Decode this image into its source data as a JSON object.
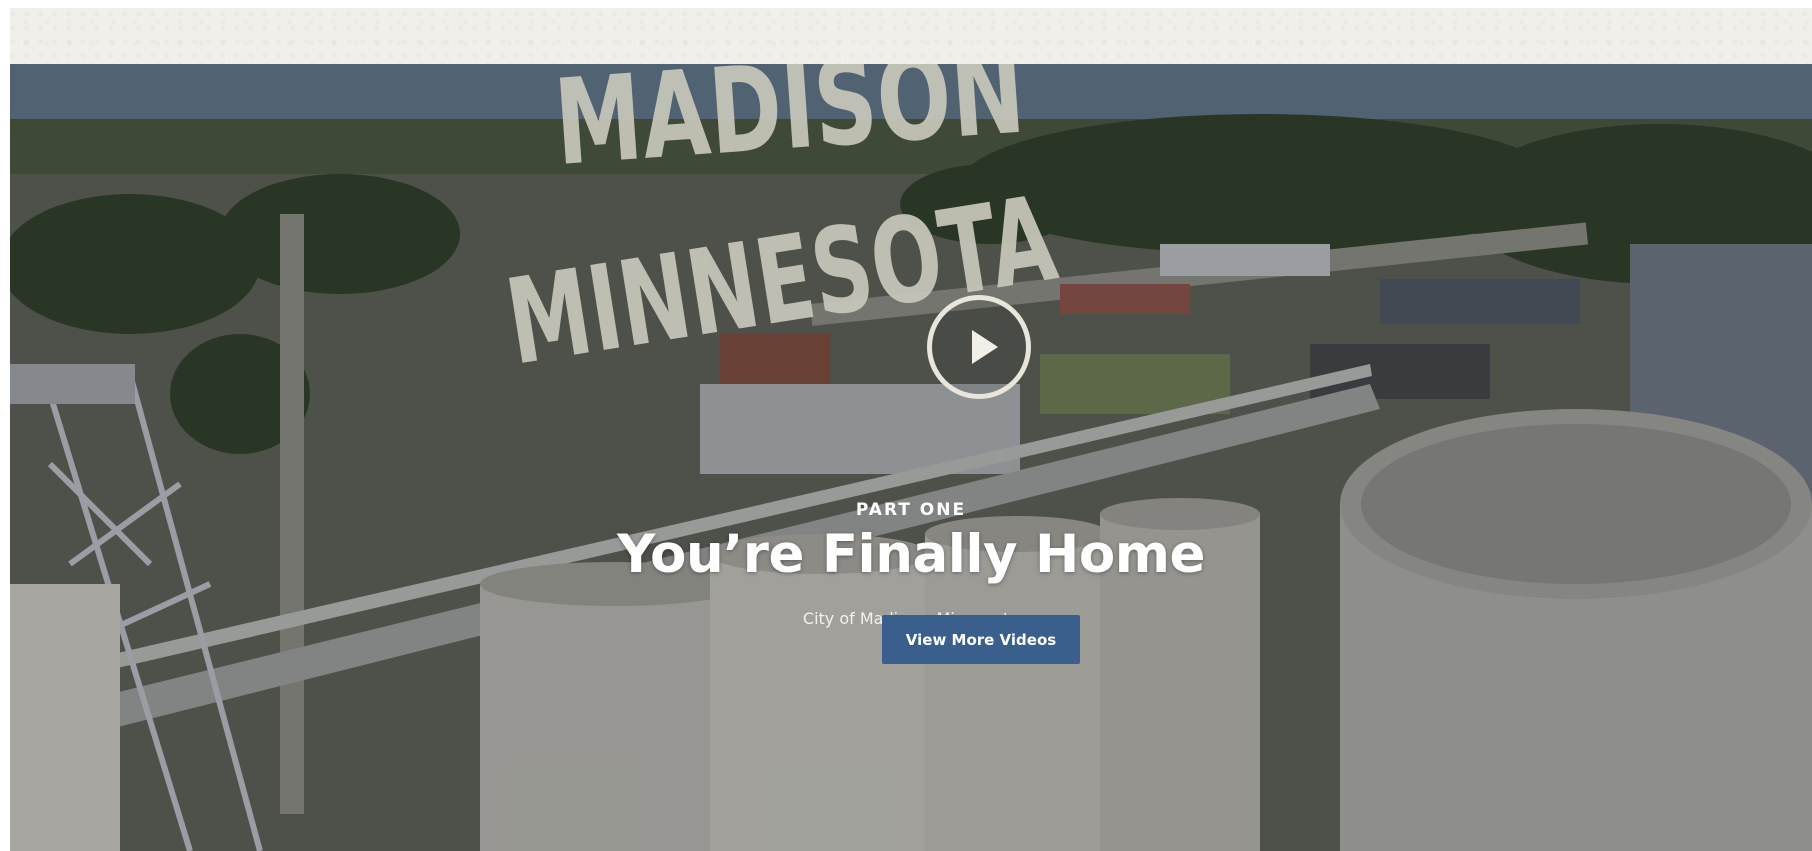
{
  "hero": {
    "wordmark_line1": "MADISON",
    "wordmark_line2": "MINNESOTA",
    "eyebrow": "PART ONE",
    "headline": "You’re Finally Home",
    "subtitle": "City of Madison, Minnesota",
    "cta_label": "View More Videos",
    "play_icon": "play-icon"
  },
  "colors": {
    "top_bar": "#f0efea",
    "cta_background": "#3b5f8c",
    "wordmark": "#c9c8bb",
    "play_ring": "#e8e6da"
  }
}
